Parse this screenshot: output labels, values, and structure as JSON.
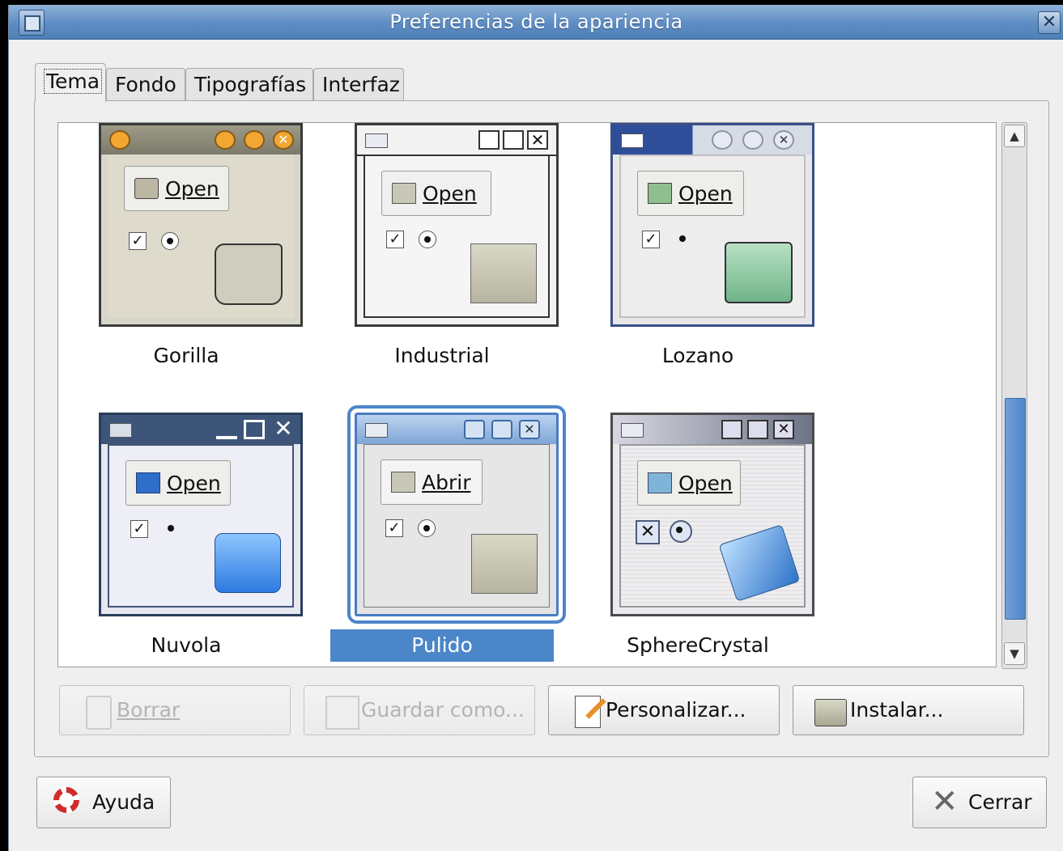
{
  "window": {
    "title": "Preferencias de la apariencia",
    "close_glyph": "✕"
  },
  "tabs": [
    {
      "label": "Tema",
      "active": true
    },
    {
      "label": "Fondo"
    },
    {
      "label": "Tipografías"
    },
    {
      "label": "Interfaz"
    }
  ],
  "themes": [
    {
      "name": "Gorilla",
      "button_label": "Open",
      "selected": false
    },
    {
      "name": "Industrial",
      "button_label": "Open",
      "selected": false
    },
    {
      "name": "Lozano",
      "button_label": "Open",
      "selected": false
    },
    {
      "name": "Nuvola",
      "button_label": "Open",
      "selected": false
    },
    {
      "name": "Pulido",
      "button_label": "Abrir",
      "selected": true
    },
    {
      "name": "SphereCrystal",
      "button_label": "Open",
      "selected": false
    }
  ],
  "actions": {
    "delete": {
      "label": "Borrar",
      "enabled": false
    },
    "save_as": {
      "label": "Guardar como...",
      "enabled": false
    },
    "customize": {
      "label": "Personalizar...",
      "enabled": true
    },
    "install": {
      "label": "Instalar...",
      "enabled": true
    }
  },
  "footer": {
    "help_label": "Ayuda",
    "close_label": "Cerrar"
  },
  "colors": {
    "selection": "#4b86c8",
    "titlebar": "#5d8dc3"
  },
  "icons": [
    "window-menu-icon",
    "close-icon",
    "trash-icon",
    "save-icon",
    "edit-icon",
    "folder-icon",
    "lifebuoy-icon",
    "x-icon",
    "chevron-up-icon",
    "chevron-down-icon"
  ]
}
